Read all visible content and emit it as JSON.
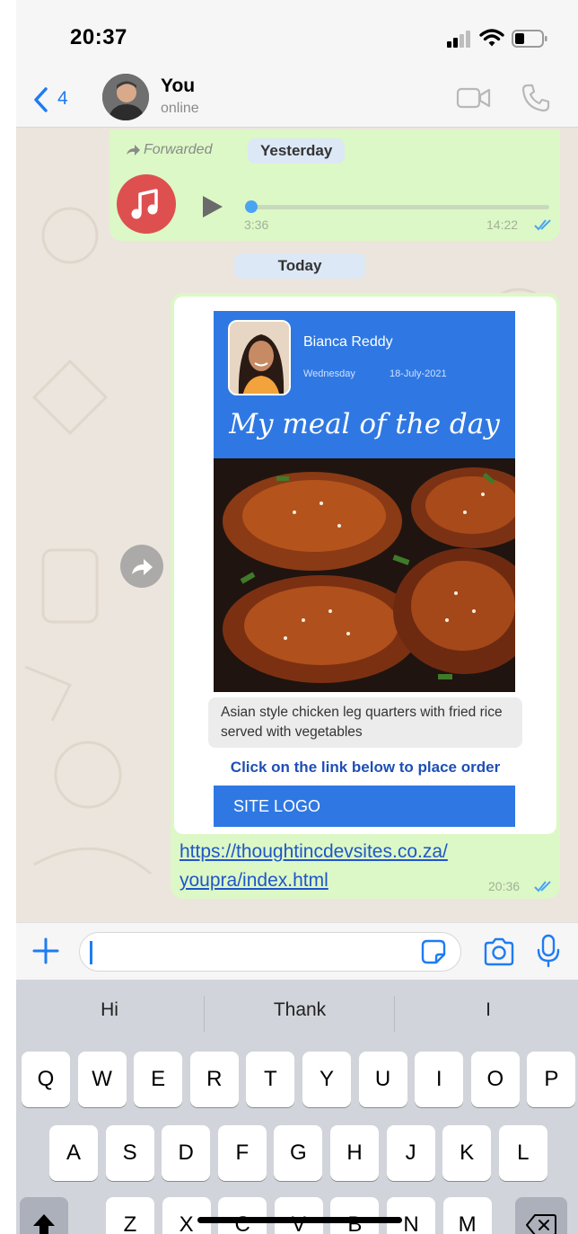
{
  "status_bar": {
    "time": "20:37"
  },
  "header": {
    "back_count": "4",
    "contact_name": "You",
    "contact_status": "online"
  },
  "messages": {
    "audio": {
      "forwarded_label": "Forwarded",
      "date_chip": "Yesterday",
      "duration": "3:36",
      "time": "14:22",
      "progress": 0.01
    },
    "date_divider": "Today",
    "card": {
      "person_name": "Bianca Reddy",
      "day": "Wednesday",
      "date": "18-July-2021",
      "title": "My meal of the day",
      "description": "Asian style chicken leg quarters with fried rice served with vegetables",
      "cta": "Click on the link below to place order",
      "site_logo": "SITE LOGO",
      "link_line1": "https://thoughtincdevsites.co.za/",
      "link_line2": "youpra/index.html",
      "time": "20:36"
    }
  },
  "input": {
    "value": "",
    "placeholder": ""
  },
  "keyboard": {
    "suggestions": [
      "Hi",
      "Thank",
      "I"
    ],
    "row1": [
      "Q",
      "W",
      "E",
      "R",
      "T",
      "Y",
      "U",
      "I",
      "O",
      "P"
    ],
    "row2": [
      "A",
      "S",
      "D",
      "F",
      "G",
      "H",
      "J",
      "K",
      "L"
    ],
    "row3": [
      "Z",
      "X",
      "C",
      "V",
      "B",
      "N",
      "M"
    ]
  },
  "colors": {
    "accent": "#1e7cf3",
    "bubble": "#dcf8c6",
    "card_blue": "#2f78e3",
    "link": "#1f56c9",
    "music": "#de5050"
  },
  "icons": {
    "back": "chevron-left-icon",
    "video": "video-camera-icon",
    "call": "phone-icon",
    "forwarded": "forward-arrow-icon",
    "music": "music-note-icon",
    "play": "play-icon",
    "read": "double-check-icon",
    "share": "share-icon",
    "plus": "plus-icon",
    "sticker": "sticker-icon",
    "camera": "camera-icon",
    "mic": "microphone-icon",
    "shift": "shift-icon",
    "delete": "backspace-icon"
  }
}
